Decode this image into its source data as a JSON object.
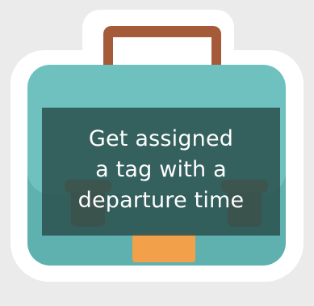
{
  "illustration": {
    "icon": "briefcase-icon",
    "colors": {
      "background": "#ebebeb",
      "sticker_outline": "#ffffff",
      "handle": "#a55a3a",
      "body_top": "#6fc1c0",
      "body_bottom": "#5fb1b0",
      "straps": "#a55a3a",
      "latch": "#f2a04a",
      "caption_bg": "#2c5250"
    }
  },
  "caption": {
    "lines": [
      "Get assigned",
      "a tag with a",
      "departure time"
    ]
  }
}
